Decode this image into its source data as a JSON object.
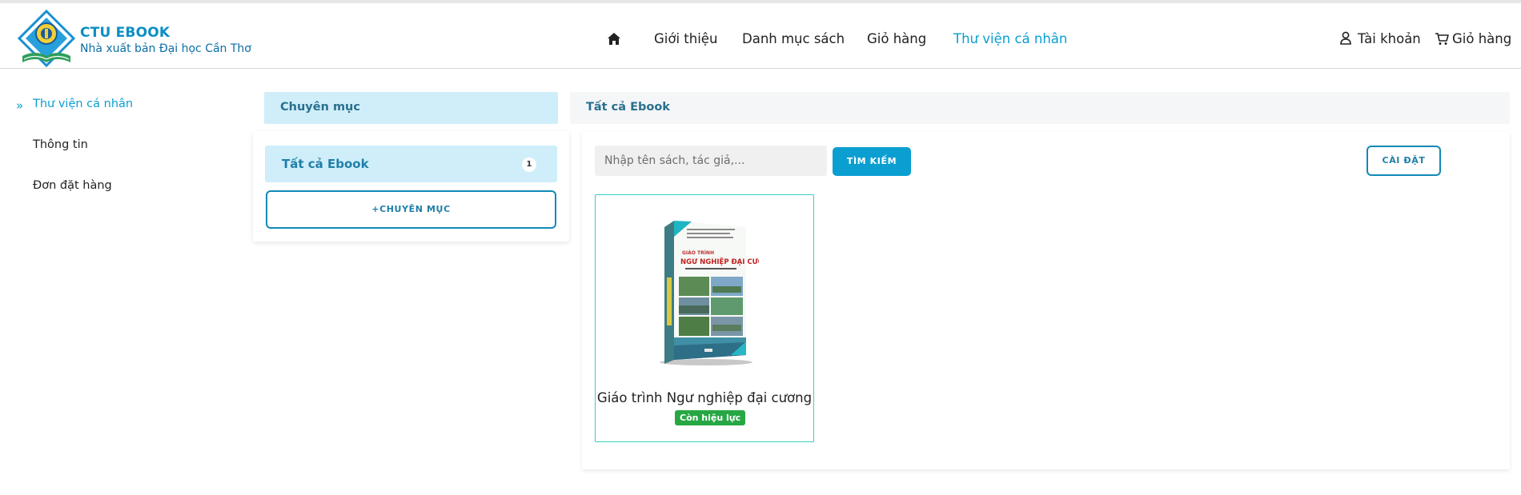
{
  "brand": {
    "title": "CTU EBOOK",
    "subtitle": "Nhà xuất bản Đại học Cần Thơ",
    "logo_icon": "ctu-press-logo-icon"
  },
  "nav": {
    "home_icon": "home-icon",
    "items": [
      {
        "label": "Giới thiệu",
        "active": false
      },
      {
        "label": "Danh mục sách",
        "active": false
      },
      {
        "label": "Giỏ hàng",
        "active": false
      },
      {
        "label": "Thư viện cá nhân",
        "active": true
      }
    ],
    "account_label": "Tài khoản",
    "cart_label": "Giỏ hàng"
  },
  "sidebar": {
    "items": [
      {
        "label": "Thư viện cá nhân",
        "active": true
      },
      {
        "label": "Thông tin",
        "active": false
      },
      {
        "label": "Đơn đặt hàng",
        "active": false
      }
    ]
  },
  "categories": {
    "header": "Chuyên mục",
    "items": [
      {
        "label": "Tất cả Ebook",
        "count": "1"
      }
    ],
    "add_button": "+CHUYÊN MỤC"
  },
  "main": {
    "header": "Tất cả Ebook",
    "search_placeholder": "Nhập tên sách, tác giả,...",
    "search_button": "TÌM KIẾM",
    "settings_button": "CÀI ĐẶT",
    "books": [
      {
        "title": "Giáo trình Ngư nghiệp đại cương",
        "status": "Còn hiệu lực",
        "cover_heading_small": "GIÁO TRÌNH",
        "cover_heading": "NGƯ NGHIỆP ĐẠI CƯƠNG"
      }
    ]
  },
  "colors": {
    "accent": "#0b9fd1",
    "category_bg": "#cfeefa",
    "badge_green": "#27a744",
    "card_border": "#35cfc0"
  }
}
